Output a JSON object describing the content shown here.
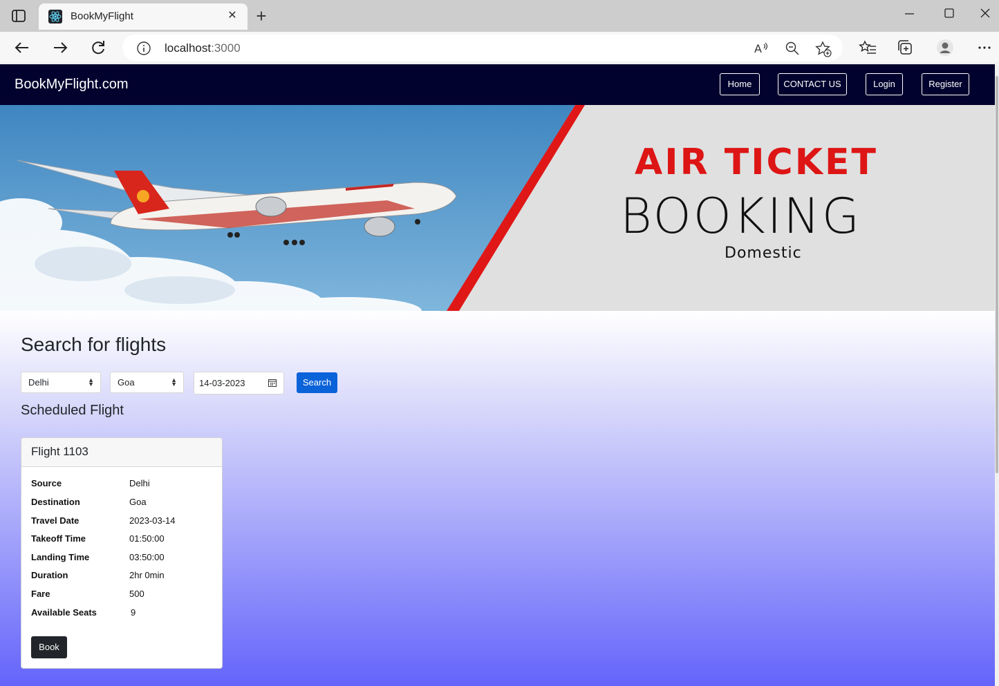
{
  "browser": {
    "tab_title": "BookMyFlight",
    "tab_close": "✕",
    "new_tab": "+",
    "address_host": "localhost",
    "address_port": ":3000"
  },
  "navbar": {
    "brand": "BookMyFlight.com",
    "links": [
      "Home",
      "CONTACT US",
      "Login",
      "Register"
    ]
  },
  "hero": {
    "line1": "AIR TICKET",
    "line2": "BOOKING",
    "line3": "Domestic"
  },
  "search": {
    "title": "Search for flights",
    "source_selected": "Delhi",
    "destination_selected": "Goa",
    "date_value": "14-03-2023",
    "button_label": "Search"
  },
  "scheduled": {
    "title": "Scheduled Flight",
    "card": {
      "title": "Flight 1103",
      "rows": [
        {
          "label": "Source",
          "value": "Delhi"
        },
        {
          "label": "Destination",
          "value": "Goa"
        },
        {
          "label": "Travel Date",
          "value": "2023-03-14"
        },
        {
          "label": "Takeoff Time",
          "value": "01:50:00"
        },
        {
          "label": "Landing Time",
          "value": "03:50:00"
        },
        {
          "label": "Duration",
          "value": "2hr 0min"
        },
        {
          "label": "Fare",
          "value": "500"
        },
        {
          "label": "Available Seats",
          "value": "9"
        }
      ],
      "book_label": "Book"
    }
  },
  "colors": {
    "navbar_bg": "#02022e",
    "search_button": "#0b63d9",
    "hero_red": "#dd1515"
  }
}
